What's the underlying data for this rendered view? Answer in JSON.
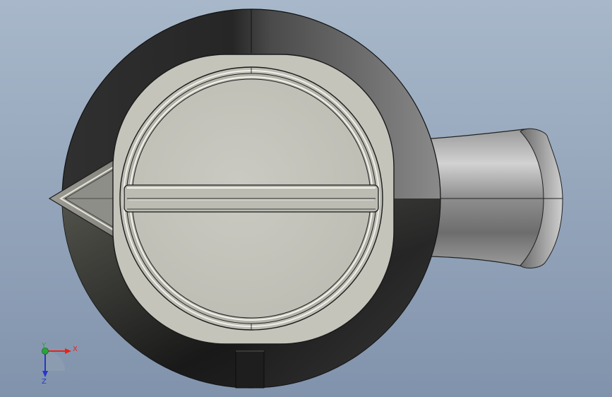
{
  "colors": {
    "background_top": "#a6b6c8",
    "background_bottom": "#7f93ad",
    "outer_body_light": "#8a8a8a",
    "outer_body_dark": "#1c1c1c",
    "cap_face": "#c6c6bd",
    "cap_rim": "#9b9b94",
    "spout_light": "#c9c9c9",
    "spout_dark": "#5f5f5f",
    "edge": "#222222",
    "axis_x": "#e8231b",
    "axis_y": "#2aa43a",
    "axis_z": "#2836c8"
  },
  "triad": {
    "x_label": "X",
    "y_label": "Y",
    "z_label": "Z"
  }
}
